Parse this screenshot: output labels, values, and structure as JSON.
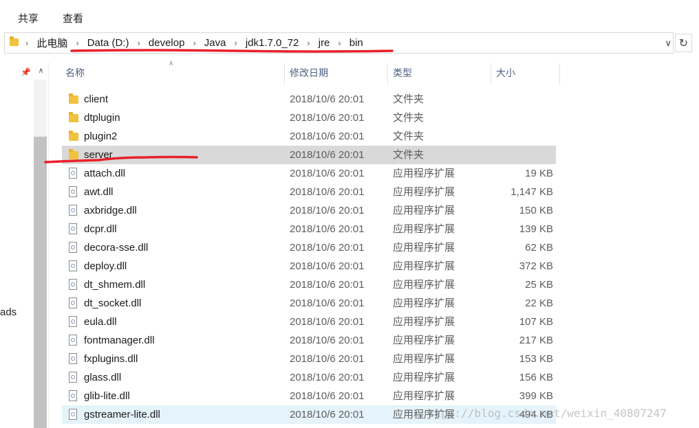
{
  "ribbon": {
    "tabs": [
      "共享",
      "查看"
    ]
  },
  "address": {
    "crumbs": [
      "此电脑",
      "Data (D:)",
      "develop",
      "Java",
      "jdk1.7.0_72",
      "jre",
      "bin"
    ]
  },
  "nav": {
    "partial_label": "ads"
  },
  "columns": {
    "name": "名称",
    "date": "修改日期",
    "type": "类型",
    "size": "大小"
  },
  "files": [
    {
      "name": "client",
      "date": "2018/10/6 20:01",
      "type": "文件夹",
      "size": "",
      "kind": "folder"
    },
    {
      "name": "dtplugin",
      "date": "2018/10/6 20:01",
      "type": "文件夹",
      "size": "",
      "kind": "folder"
    },
    {
      "name": "plugin2",
      "date": "2018/10/6 20:01",
      "type": "文件夹",
      "size": "",
      "kind": "folder"
    },
    {
      "name": "server",
      "date": "2018/10/6 20:01",
      "type": "文件夹",
      "size": "",
      "kind": "folder",
      "state": "selected"
    },
    {
      "name": "attach.dll",
      "date": "2018/10/6 20:01",
      "type": "应用程序扩展",
      "size": "19 KB",
      "kind": "dll"
    },
    {
      "name": "awt.dll",
      "date": "2018/10/6 20:01",
      "type": "应用程序扩展",
      "size": "1,147 KB",
      "kind": "dll"
    },
    {
      "name": "axbridge.dll",
      "date": "2018/10/6 20:01",
      "type": "应用程序扩展",
      "size": "150 KB",
      "kind": "dll"
    },
    {
      "name": "dcpr.dll",
      "date": "2018/10/6 20:01",
      "type": "应用程序扩展",
      "size": "139 KB",
      "kind": "dll"
    },
    {
      "name": "decora-sse.dll",
      "date": "2018/10/6 20:01",
      "type": "应用程序扩展",
      "size": "62 KB",
      "kind": "dll"
    },
    {
      "name": "deploy.dll",
      "date": "2018/10/6 20:01",
      "type": "应用程序扩展",
      "size": "372 KB",
      "kind": "dll"
    },
    {
      "name": "dt_shmem.dll",
      "date": "2018/10/6 20:01",
      "type": "应用程序扩展",
      "size": "25 KB",
      "kind": "dll"
    },
    {
      "name": "dt_socket.dll",
      "date": "2018/10/6 20:01",
      "type": "应用程序扩展",
      "size": "22 KB",
      "kind": "dll"
    },
    {
      "name": "eula.dll",
      "date": "2018/10/6 20:01",
      "type": "应用程序扩展",
      "size": "107 KB",
      "kind": "dll"
    },
    {
      "name": "fontmanager.dll",
      "date": "2018/10/6 20:01",
      "type": "应用程序扩展",
      "size": "217 KB",
      "kind": "dll"
    },
    {
      "name": "fxplugins.dll",
      "date": "2018/10/6 20:01",
      "type": "应用程序扩展",
      "size": "153 KB",
      "kind": "dll"
    },
    {
      "name": "glass.dll",
      "date": "2018/10/6 20:01",
      "type": "应用程序扩展",
      "size": "156 KB",
      "kind": "dll"
    },
    {
      "name": "glib-lite.dll",
      "date": "2018/10/6 20:01",
      "type": "应用程序扩展",
      "size": "399 KB",
      "kind": "dll"
    },
    {
      "name": "gstreamer-lite.dll",
      "date": "2018/10/6 20:01",
      "type": "应用程序扩展",
      "size": "494 KB",
      "kind": "dll",
      "state": "hovered"
    }
  ],
  "watermark": "ttps://blog.csdn.net/weixin_40807247",
  "colors": {
    "selected_row": "#d9d9d9",
    "hover_row": "#e5f3fb",
    "annotation_red": "#e8202a",
    "folder": "#f0c23f"
  }
}
